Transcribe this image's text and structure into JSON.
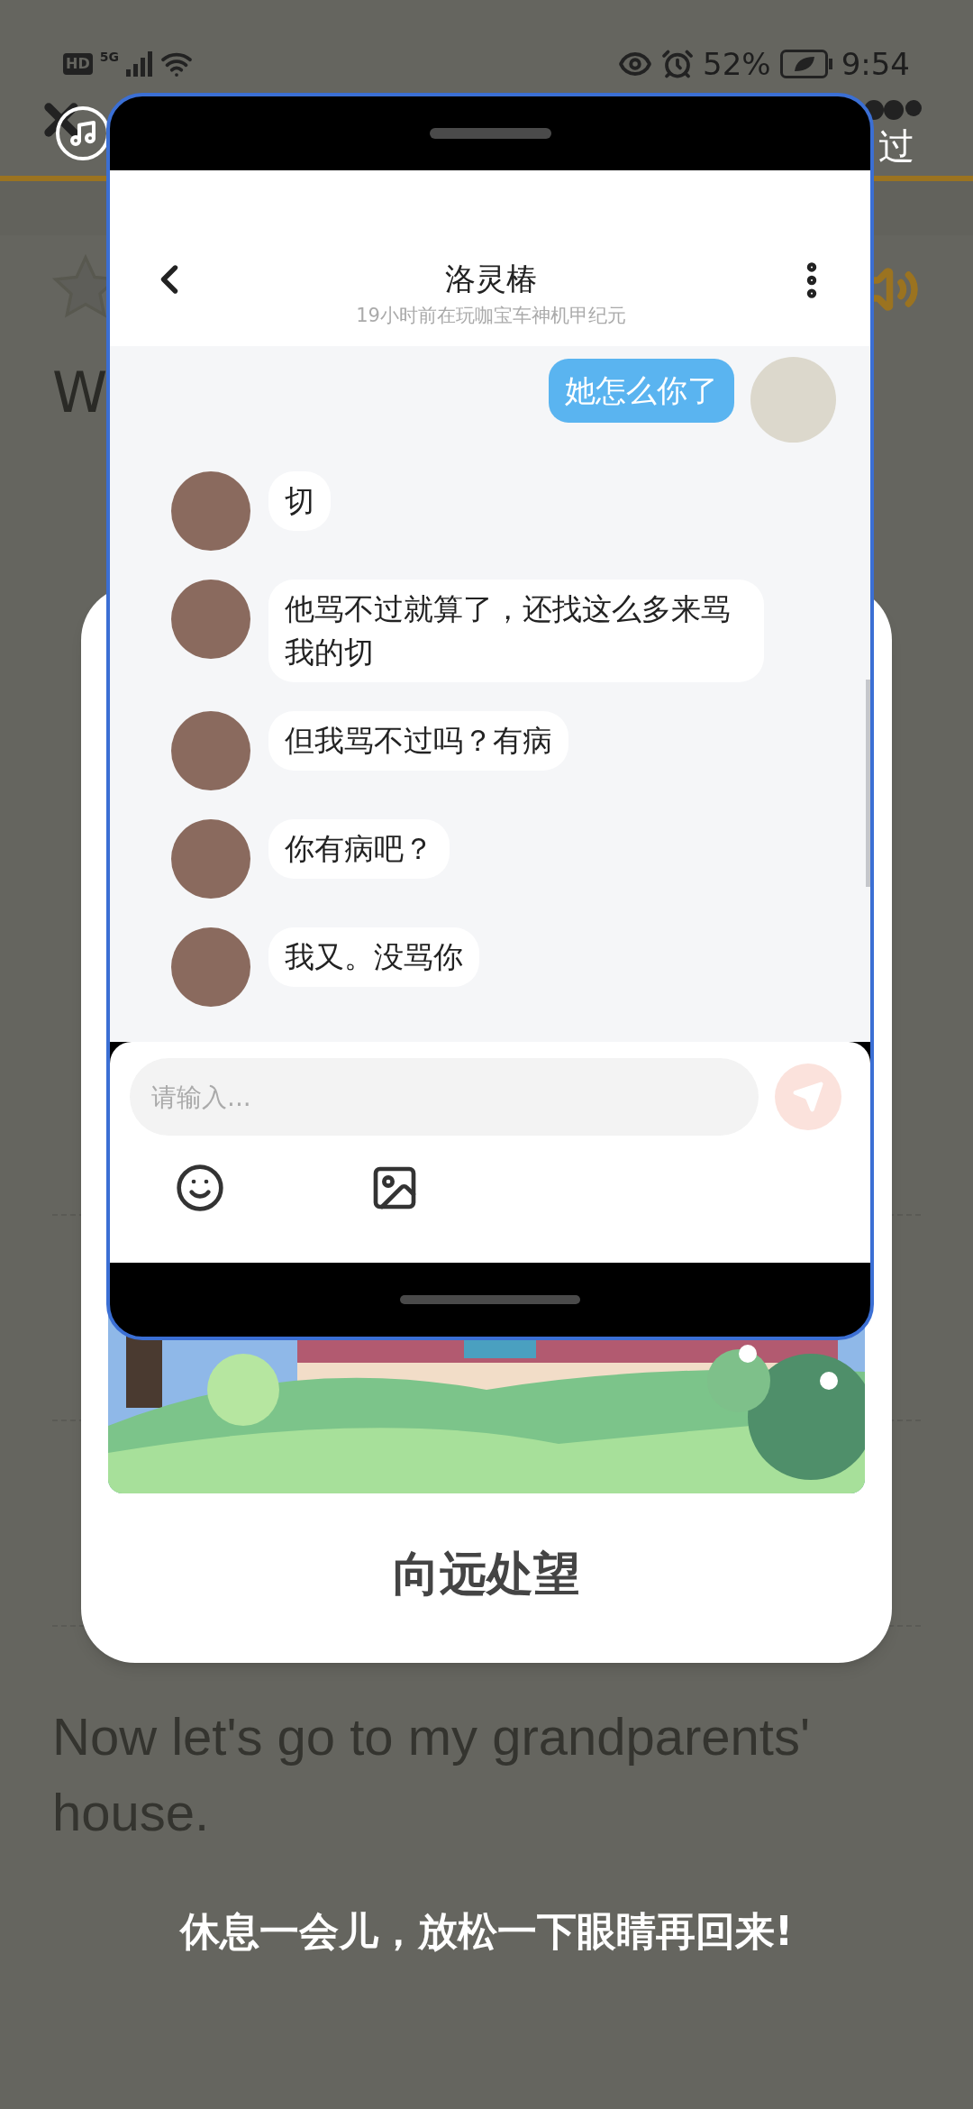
{
  "status_bar": {
    "hd_label": "HD",
    "network": "5G",
    "battery": "52%",
    "time": "9:54"
  },
  "background_app": {
    "skip_label": "过",
    "heading": "W",
    "progress": {
      "level": 1
    },
    "sentence": "Now let's go to my grandparents' house."
  },
  "break_card": {
    "caption": "向远处望"
  },
  "floating_window": {
    "chat": {
      "title": "洛灵椿",
      "subtitle": "19小时前在玩咖宝车神机甲纪元",
      "messages": [
        {
          "kind": "sent",
          "text": "她怎么你了"
        },
        {
          "kind": "received",
          "text": "切"
        },
        {
          "kind": "received",
          "text": "他骂不过就算了，还找这么多来骂我的切"
        },
        {
          "kind": "received",
          "text": "但我骂不过吗？有病"
        },
        {
          "kind": "received",
          "text": "你有病吧？"
        },
        {
          "kind": "received",
          "text": "我又。没骂你"
        }
      ],
      "input": {
        "placeholder": "请输入..."
      }
    }
  },
  "break_message": "休息一会儿，放松一下眼睛再回来!"
}
